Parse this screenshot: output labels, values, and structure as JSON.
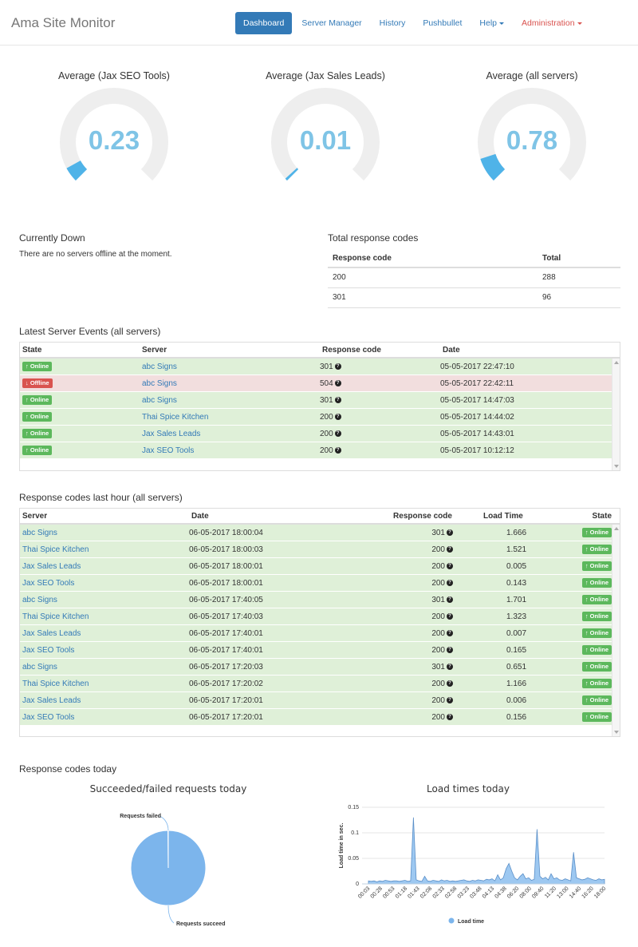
{
  "app": {
    "brand": "Ama Site Monitor"
  },
  "nav": {
    "dashboard": "Dashboard",
    "server_manager": "Server Manager",
    "history": "History",
    "pushbullet": "Pushbullet",
    "help": "Help",
    "administration": "Administration"
  },
  "gauges": [
    {
      "title": "Average (Jax SEO Tools)",
      "value": "0.23",
      "fill_fraction": 0.06
    },
    {
      "title": "Average (Jax Sales Leads)",
      "value": "0.01",
      "fill_fraction": 0.01
    },
    {
      "title": "Average (all servers)",
      "value": "0.78",
      "fill_fraction": 0.1
    }
  ],
  "currently_down": {
    "title": "Currently Down",
    "message": "There are no servers offline at the moment."
  },
  "total_codes": {
    "title": "Total response codes",
    "headers": [
      "Response code",
      "Total"
    ],
    "rows": [
      [
        "200",
        "288"
      ],
      [
        "301",
        "96"
      ]
    ]
  },
  "events": {
    "title": "Latest Server Events (all servers)",
    "headers": [
      "State",
      "Server",
      "Response code",
      "Date"
    ],
    "rows": [
      {
        "state": "Online",
        "server": "abc Signs",
        "code": "301",
        "date": "05-05-2017 22:47:10"
      },
      {
        "state": "Offline",
        "server": "abc Signs",
        "code": "504",
        "date": "05-05-2017 22:42:11"
      },
      {
        "state": "Online",
        "server": "abc Signs",
        "code": "301",
        "date": "05-05-2017 14:47:03"
      },
      {
        "state": "Online",
        "server": "Thai Spice Kitchen",
        "code": "200",
        "date": "05-05-2017 14:44:02"
      },
      {
        "state": "Online",
        "server": "Jax Sales Leads",
        "code": "200",
        "date": "05-05-2017 14:43:01"
      },
      {
        "state": "Online",
        "server": "Jax SEO Tools",
        "code": "200",
        "date": "05-05-2017 10:12:12"
      }
    ]
  },
  "last_hour": {
    "title": "Response codes last hour (all servers)",
    "headers": [
      "Server",
      "Date",
      "Response code",
      "Load Time",
      "State"
    ],
    "rows": [
      {
        "server": "abc Signs",
        "date": "06-05-2017 18:00:04",
        "code": "301",
        "load": "1.666",
        "state": "Online"
      },
      {
        "server": "Thai Spice Kitchen",
        "date": "06-05-2017 18:00:03",
        "code": "200",
        "load": "1.521",
        "state": "Online"
      },
      {
        "server": "Jax Sales Leads",
        "date": "06-05-2017 18:00:01",
        "code": "200",
        "load": "0.005",
        "state": "Online"
      },
      {
        "server": "Jax SEO Tools",
        "date": "06-05-2017 18:00:01",
        "code": "200",
        "load": "0.143",
        "state": "Online"
      },
      {
        "server": "abc Signs",
        "date": "06-05-2017 17:40:05",
        "code": "301",
        "load": "1.701",
        "state": "Online"
      },
      {
        "server": "Thai Spice Kitchen",
        "date": "06-05-2017 17:40:03",
        "code": "200",
        "load": "1.323",
        "state": "Online"
      },
      {
        "server": "Jax Sales Leads",
        "date": "06-05-2017 17:40:01",
        "code": "200",
        "load": "0.007",
        "state": "Online"
      },
      {
        "server": "Jax SEO Tools",
        "date": "06-05-2017 17:40:01",
        "code": "200",
        "load": "0.165",
        "state": "Online"
      },
      {
        "server": "abc Signs",
        "date": "06-05-2017 17:20:03",
        "code": "301",
        "load": "0.651",
        "state": "Online"
      },
      {
        "server": "Thai Spice Kitchen",
        "date": "06-05-2017 17:20:02",
        "code": "200",
        "load": "1.166",
        "state": "Online"
      },
      {
        "server": "Jax Sales Leads",
        "date": "06-05-2017 17:20:01",
        "code": "200",
        "load": "0.006",
        "state": "Online"
      },
      {
        "server": "Jax SEO Tools",
        "date": "06-05-2017 17:20:01",
        "code": "200",
        "load": "0.156",
        "state": "Online"
      }
    ]
  },
  "today": {
    "title": "Response codes today"
  },
  "colors": {
    "accent": "#337ab7",
    "gauge_value": "#7fc4e6",
    "gauge_fill": "#4fb3e8",
    "online": "#5cb85c",
    "offline": "#d9534f",
    "series": "#7cb5ec"
  },
  "chart_data": [
    {
      "type": "pie",
      "title": "Succeeded/failed requests today",
      "labels": [
        "Requests succeed",
        "Requests failed"
      ],
      "values": [
        99.9,
        0.1
      ]
    },
    {
      "type": "area",
      "title": "Load times today",
      "ylabel": "Load time in sec.",
      "ylim": [
        0,
        0.15
      ],
      "yticks": [
        "0",
        "0.05",
        "0.1",
        "0.15"
      ],
      "xticks": [
        "00:03",
        "00:28",
        "00:53",
        "01:18",
        "01:43",
        "02:08",
        "02:33",
        "02:58",
        "03:23",
        "03:48",
        "04:13",
        "04:38",
        "06:20",
        "08:00",
        "09:40",
        "11:20",
        "13:00",
        "14:40",
        "16:20",
        "18:00"
      ],
      "series": [
        {
          "name": "Load time",
          "values": [
            0.006,
            0.005,
            0.006,
            0.004,
            0.006,
            0.005,
            0.007,
            0.006,
            0.005,
            0.006,
            0.006,
            0.005,
            0.006,
            0.007,
            0.005,
            0.006,
            0.13,
            0.008,
            0.006,
            0.005,
            0.015,
            0.006,
            0.005,
            0.007,
            0.006,
            0.005,
            0.008,
            0.006,
            0.007,
            0.005,
            0.006,
            0.005,
            0.006,
            0.007,
            0.008,
            0.006,
            0.005,
            0.007,
            0.006,
            0.008,
            0.007,
            0.006,
            0.009,
            0.008,
            0.01,
            0.006,
            0.018,
            0.008,
            0.012,
            0.03,
            0.04,
            0.025,
            0.012,
            0.008,
            0.015,
            0.02,
            0.01,
            0.012,
            0.007,
            0.009,
            0.107,
            0.015,
            0.01,
            0.013,
            0.008,
            0.02,
            0.01,
            0.012,
            0.008,
            0.007,
            0.01,
            0.008,
            0.006,
            0.062,
            0.012,
            0.01,
            0.008,
            0.009,
            0.012,
            0.01,
            0.008,
            0.007,
            0.01,
            0.008,
            0.009
          ]
        }
      ]
    }
  ]
}
